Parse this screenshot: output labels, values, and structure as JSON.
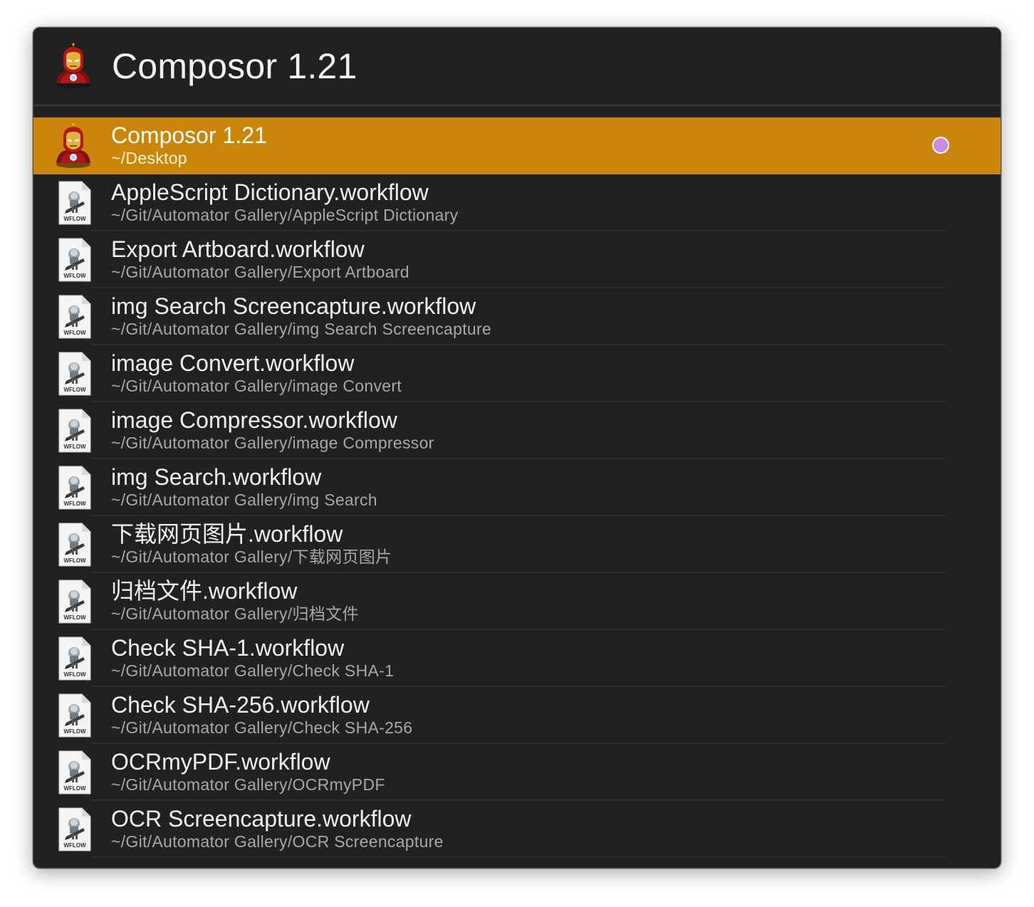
{
  "search": {
    "query": "Composor 1.21",
    "app_icon": "iron-man-app-icon"
  },
  "results": [
    {
      "title": "Composor 1.21",
      "subtitle": "~/Desktop",
      "icon": "iron-man-app-icon",
      "selected": true,
      "tag_color": "#cf8ae0"
    },
    {
      "title": "AppleScript Dictionary.workflow",
      "subtitle": "~/Git/Automator Gallery/AppleScript Dictionary",
      "icon": "workflow-file-icon",
      "icon_label": "WFLOW"
    },
    {
      "title": "Export Artboard.workflow",
      "subtitle": "~/Git/Automator Gallery/Export Artboard",
      "icon": "workflow-file-icon",
      "icon_label": "WFLOW"
    },
    {
      "title": "img Search Screencapture.workflow",
      "subtitle": "~/Git/Automator Gallery/img Search Screencapture",
      "icon": "workflow-file-icon",
      "icon_label": "WFLOW"
    },
    {
      "title": "image Convert.workflow",
      "subtitle": "~/Git/Automator Gallery/image Convert",
      "icon": "workflow-file-icon",
      "icon_label": "WFLOW"
    },
    {
      "title": "image Compressor.workflow",
      "subtitle": "~/Git/Automator Gallery/image Compressor",
      "icon": "workflow-file-icon",
      "icon_label": "WFLOW"
    },
    {
      "title": "img Search.workflow",
      "subtitle": "~/Git/Automator Gallery/img Search",
      "icon": "workflow-file-icon",
      "icon_label": "WFLOW"
    },
    {
      "title": "下载网页图片.workflow",
      "subtitle": "~/Git/Automator Gallery/下载网页图片",
      "icon": "workflow-file-icon",
      "icon_label": "WFLOW"
    },
    {
      "title": "归档文件.workflow",
      "subtitle": "~/Git/Automator Gallery/归档文件",
      "icon": "workflow-file-icon",
      "icon_label": "WFLOW"
    },
    {
      "title": "Check SHA-1.workflow",
      "subtitle": "~/Git/Automator Gallery/Check SHA-1",
      "icon": "workflow-file-icon",
      "icon_label": "WFLOW"
    },
    {
      "title": "Check SHA-256.workflow",
      "subtitle": "~/Git/Automator Gallery/Check SHA-256",
      "icon": "workflow-file-icon",
      "icon_label": "WFLOW"
    },
    {
      "title": "OCRmyPDF.workflow",
      "subtitle": "~/Git/Automator Gallery/OCRmyPDF",
      "icon": "workflow-file-icon",
      "icon_label": "WFLOW"
    },
    {
      "title": "OCR Screencapture.workflow",
      "subtitle": "~/Git/Automator Gallery/OCR Screencapture",
      "icon": "workflow-file-icon",
      "icon_label": "WFLOW"
    }
  ]
}
